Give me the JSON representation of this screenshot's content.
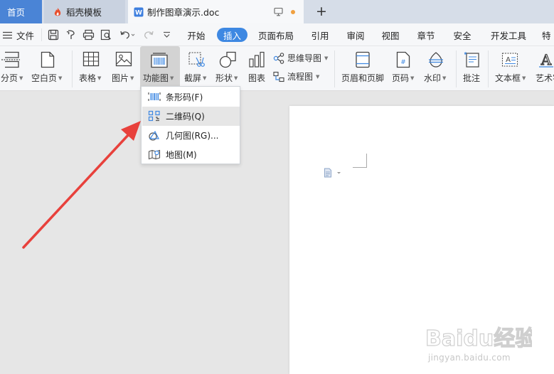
{
  "tabs": {
    "home": "首页",
    "templates": "稻壳模板",
    "document": "制作图章演示.doc"
  },
  "menu": {
    "file": "文件",
    "tabs": [
      "开始",
      "插入",
      "页面布局",
      "引用",
      "审阅",
      "视图",
      "章节",
      "安全",
      "开发工具",
      "特"
    ],
    "active_tab": "插入"
  },
  "ribbon": {
    "page_break": "分页",
    "blank_page": "空白页",
    "table": "表格",
    "picture": "图片",
    "function_chart": "功能图",
    "screenshot": "截屏",
    "shapes": "形状",
    "chart": "图表",
    "mind_map": "思维导图",
    "flowchart": "流程图",
    "header_footer": "页眉和页脚",
    "page_number": "页码",
    "watermark": "水印",
    "comment": "批注",
    "text_box": "文本框",
    "word_art": "艺术字"
  },
  "dropdown": {
    "items": [
      "条形码(F)",
      "二维码(Q)",
      "几何图(RG)...",
      "地图(M)"
    ],
    "highlighted": "二维码(Q)"
  },
  "watermark": {
    "brand": "Baidu经验",
    "url": "jingyan.baidu.com"
  },
  "colors": {
    "accent": "#3e88e2",
    "arrow": "#e8413c",
    "home_tab": "#4a84d6"
  }
}
